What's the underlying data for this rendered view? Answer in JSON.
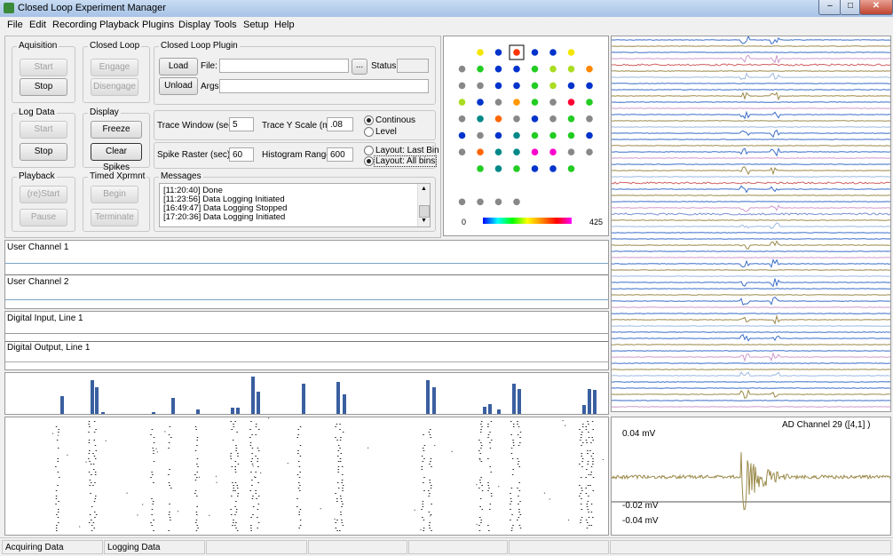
{
  "window": {
    "title": "Closed Loop Experiment Manager"
  },
  "menu": [
    "File",
    "Edit",
    "Recording",
    "Playback",
    "Plugins",
    "Display",
    "Tools",
    "Setup",
    "Help"
  ],
  "acquisition": {
    "title": "Aquisition",
    "start": "Start",
    "stop": "Stop"
  },
  "closed_loop": {
    "title": "Closed Loop",
    "engage": "Engage",
    "disengage": "Disengage"
  },
  "plugin": {
    "title": "Closed Loop Plugin",
    "load": "Load",
    "unload": "Unload",
    "file_label": "File:",
    "file_value": "",
    "browse": "...",
    "status_label": "Status:",
    "status_value": "",
    "args_label": "Args:",
    "args_value": ""
  },
  "log_data": {
    "title": "Log Data",
    "start": "Start",
    "stop": "Stop"
  },
  "display": {
    "title": "Display",
    "freeze": "Freeze",
    "clear_spikes": "Clear Spikes"
  },
  "trace": {
    "window_label": "Trace Window (sec):",
    "window_value": "5",
    "yscale_label": "Trace Y Scale (mV)",
    "yscale_value": ".08",
    "continuous": "Continous",
    "level": "Level",
    "mode_selected": "Continous"
  },
  "spike": {
    "raster_label": "Spike Raster (sec):",
    "raster_value": "60",
    "hist_label": "Histogram Range:",
    "hist_value": "600",
    "layout_last": "Layout: Last Bin",
    "layout_all": "Layout: All bins",
    "layout_selected": "Layout: All bins"
  },
  "playback": {
    "title": "Playback",
    "restart": "(re)Start",
    "pause": "Pause"
  },
  "timed": {
    "title": "Timed Xprmnt",
    "begin": "Begin",
    "terminate": "Terminate"
  },
  "messages": {
    "title": "Messages",
    "lines": [
      "[11:20:40] Done",
      "[11:23:56] Data Logging Initiated",
      "[16:49:47] Data Logging Stopped",
      "[17:20:36] Data Logging Initiated"
    ]
  },
  "electrode_map": {
    "scale_min": "0",
    "scale_max": "425",
    "selected": [
      4,
      1
    ],
    "rows": [
      [
        "",
        "",
        "#f5e600",
        "#0033cc",
        "#ff3300",
        "#0033cc",
        "#0033cc",
        "#f5e600",
        ""
      ],
      [
        "",
        "#888888",
        "#22cc22",
        "#0033cc",
        "#0033cc",
        "#22cc22",
        "#aadd22",
        "#aadd22",
        "#ff8800"
      ],
      [
        "",
        "#888888",
        "#888888",
        "#0033cc",
        "#0033cc",
        "#22cc22",
        "#aadd22",
        "#0033cc",
        "#0033cc"
      ],
      [
        "",
        "#aadd22",
        "#0033cc",
        "#888888",
        "#ff9900",
        "#22cc22",
        "#888888",
        "#ff0033",
        "#22cc22"
      ],
      [
        "",
        "#888888",
        "#008888",
        "#ff6600",
        "#888888",
        "#0033cc",
        "#888888",
        "#22cc22",
        "#888888"
      ],
      [
        "",
        "#0033cc",
        "#888888",
        "#0033cc",
        "#008888",
        "#22cc22",
        "#22cc22",
        "#22cc22",
        "#0033cc"
      ],
      [
        "",
        "#888888",
        "#ff6600",
        "#008888",
        "#008888",
        "#ff00cc",
        "#ff00cc",
        "#888888",
        "#888888"
      ],
      [
        "",
        "",
        "#22cc22",
        "#008888",
        "#22cc22",
        "#0033cc",
        "#0033cc",
        "#22cc22",
        ""
      ],
      [
        "",
        "",
        "",
        "",
        "",
        "",
        "",
        "",
        ""
      ],
      [
        "",
        "#888888",
        "#888888",
        "#888888",
        "#888888",
        "",
        "",
        "",
        ""
      ]
    ]
  },
  "user_channels": [
    "User Channel 1",
    "User Channel 2"
  ],
  "digital": {
    "input": "Digital Input, Line 1",
    "output": "Digital Output, Line 1"
  },
  "histogram": {
    "bars": [
      [
        62,
        20
      ],
      [
        96,
        38
      ],
      [
        101,
        30
      ],
      [
        108,
        2
      ],
      [
        165,
        2
      ],
      [
        187,
        18
      ],
      [
        215,
        5
      ],
      [
        254,
        7
      ],
      [
        260,
        7
      ],
      [
        277,
        42
      ],
      [
        283,
        25
      ],
      [
        334,
        34
      ],
      [
        373,
        36
      ],
      [
        380,
        22
      ],
      [
        474,
        38
      ],
      [
        481,
        30
      ],
      [
        538,
        8
      ],
      [
        544,
        11
      ],
      [
        554,
        5
      ],
      [
        571,
        34
      ],
      [
        577,
        28
      ],
      [
        650,
        10
      ],
      [
        656,
        28
      ],
      [
        662,
        27
      ]
    ]
  },
  "ad_channel": {
    "title": "AD Channel 29 ([4,1] )",
    "labels": [
      "0.04 mV",
      "-0.02 mV",
      "-0.04 mV"
    ]
  },
  "status_bar": [
    "Acquiring Data",
    "Logging Data",
    "",
    "",
    "",
    "",
    ""
  ],
  "colors": {
    "trace_olive": "#9a8a4a",
    "trace_blue": "#3b6ec8",
    "trace_red": "#d06060",
    "hist_bar": "#3a5fa0"
  }
}
